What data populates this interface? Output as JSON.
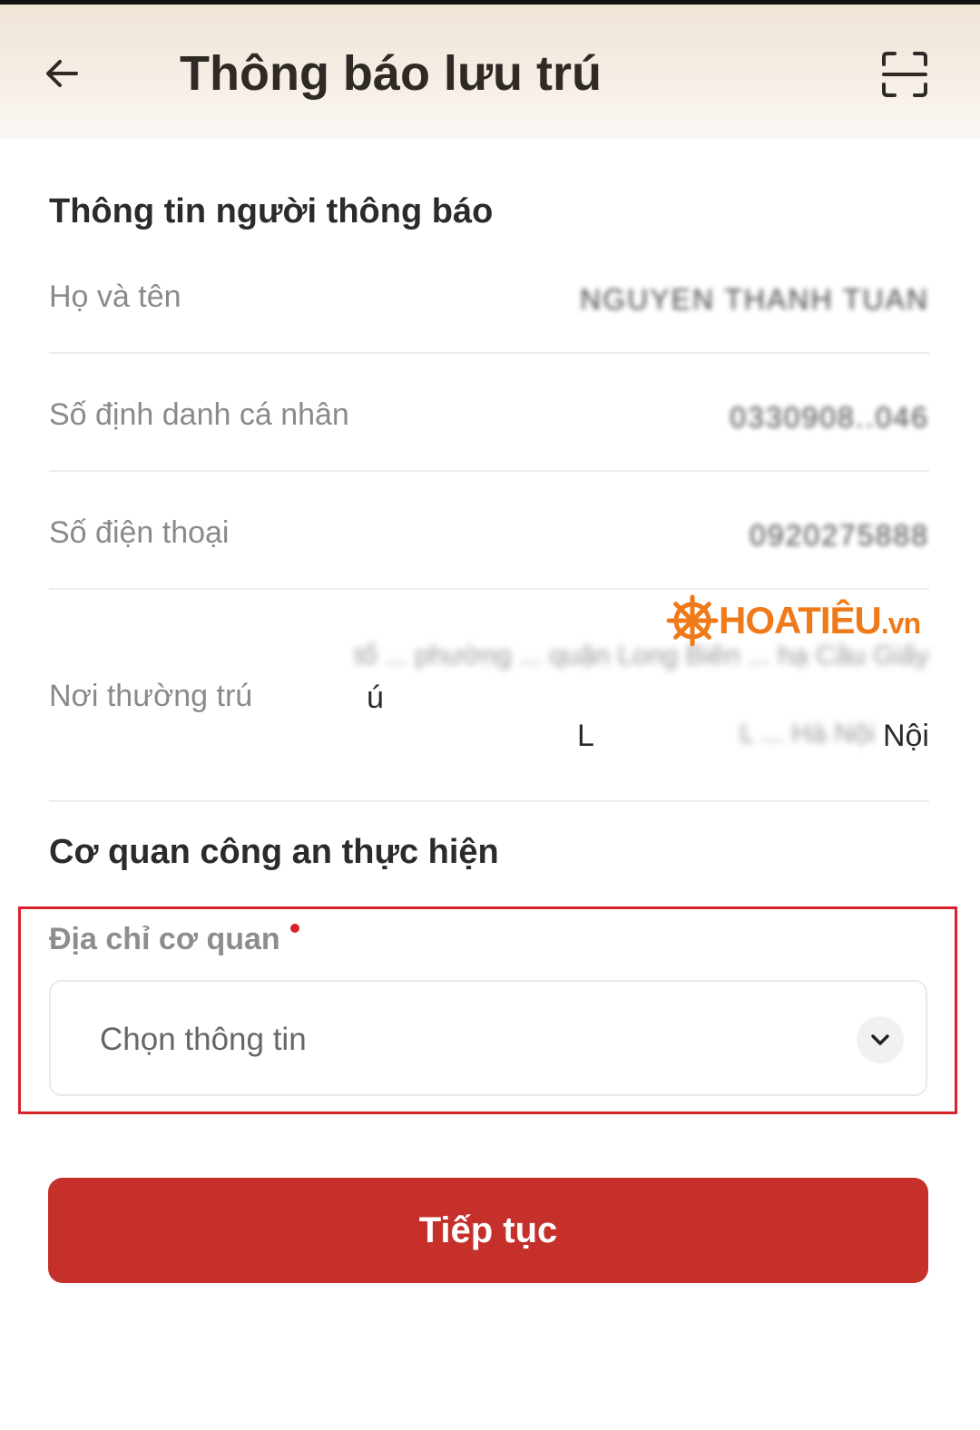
{
  "header": {
    "title": "Thông báo lưu trú",
    "back_icon": "arrow-left-icon",
    "scan_icon": "scan-frame-icon"
  },
  "notifier_section": {
    "title": "Thông tin người thông báo",
    "rows": [
      {
        "label": "Họ và tên",
        "value": "NGUYEN THANH TUAN"
      },
      {
        "label": "Số định danh cá nhân",
        "value": "0330908..046"
      },
      {
        "label": "Số điện thoại",
        "value": "0920275888"
      },
      {
        "label": "Nơi thường trú",
        "address_line1": "tổ ... phường ... quận Long Biên ... hạ Cầu Giấy",
        "address_line2": "L ... Hà Nội",
        "visible_fragment_1": "ú",
        "visible_fragment_2": "L",
        "visible_fragment_3": "Nội"
      }
    ]
  },
  "watermark": {
    "brand": "HOATIÊU",
    "suffix": ".vn",
    "icon": "ship-wheel-icon"
  },
  "police_section": {
    "title": "Cơ quan công an thực hiện",
    "field_label": "Địa chỉ cơ quan",
    "select_placeholder": "Chọn thông tin",
    "chevron_icon": "chevron-down-icon"
  },
  "actions": {
    "continue_label": "Tiếp tục"
  },
  "colors": {
    "primary": "#c5302b",
    "highlight": "#d8232a",
    "watermark": "#ef7a1a"
  }
}
